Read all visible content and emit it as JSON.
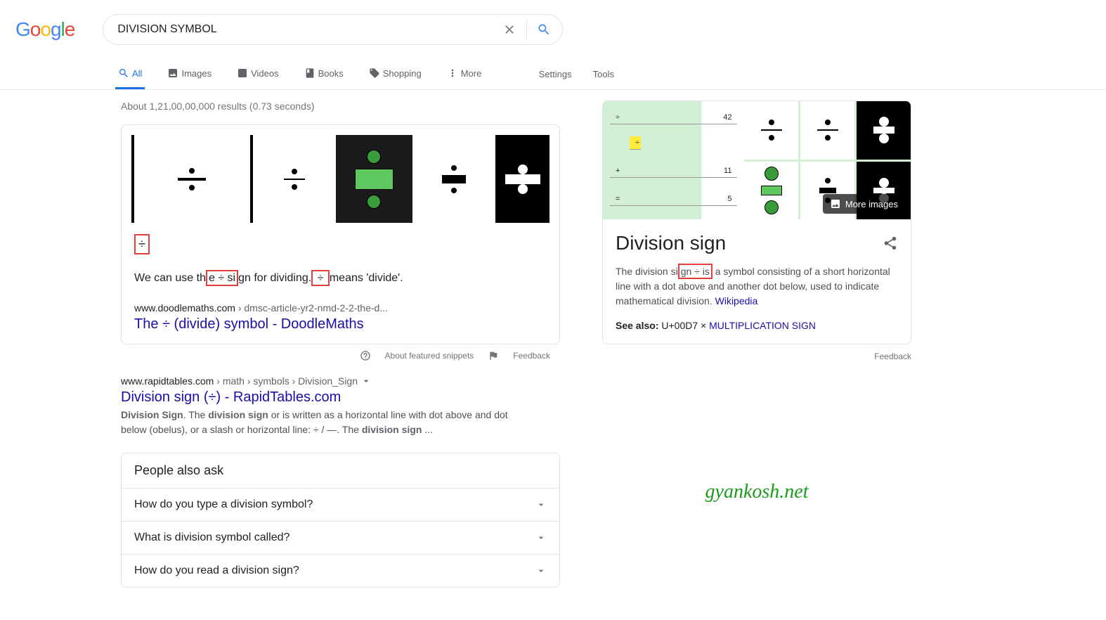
{
  "search": {
    "query": "DIVISION SYMBOL"
  },
  "tabs": {
    "all": "All",
    "images": "Images",
    "videos": "Videos",
    "books": "Books",
    "shopping": "Shopping",
    "more": "More",
    "settings": "Settings",
    "tools": "Tools"
  },
  "stats": "About 1,21,00,00,000 results (0.73 seconds)",
  "featured": {
    "symbol": "÷",
    "text_pre": "We can use th",
    "text_mid1": "e ÷ si",
    "text_mid2": "gn for dividing.",
    "text_box2": " ÷ ",
    "text_post": "means 'divide'.",
    "url": "www.doodlemaths.com",
    "path": " › dmsc-article-yr2-nmd-2-2-the-d...",
    "title": "The ÷ (divide) symbol - DoodleMaths",
    "about": "About featured snippets",
    "feedback": "Feedback"
  },
  "results": [
    {
      "url": "www.rapidtables.com",
      "path": " › math › symbols › Division_Sign",
      "title": "Division sign (÷) - RapidTables.com",
      "snippet_b1": "Division Sign",
      "snippet_1": ". The ",
      "snippet_b2": "division sign",
      "snippet_2": " or is written as a horizontal line with dot above and dot below (obelus), or a slash or horizontal line: ÷ / —. The ",
      "snippet_b3": "division sign",
      "snippet_3": " ..."
    }
  ],
  "paa": {
    "title": "People also ask",
    "q1": "How do you type a division symbol?",
    "q2": "What is division symbol called?",
    "q3": "How do you read a division sign?"
  },
  "kp": {
    "title": "Division sign",
    "more_images": "More images",
    "desc_pre": "The division si",
    "desc_box": "gn ÷ is",
    "desc_post": " a symbol consisting of a short horizontal line with a dot above and another dot below, used to indicate mathematical division. ",
    "wiki": "Wikipedia",
    "seealso_label": "See also:",
    "seealso_code": " U+00D7 × ",
    "seealso_link": "MULTIPLICATION SIGN",
    "feedback": "Feedback",
    "cells": {
      "sym1": "÷",
      "val1": "42",
      "sym2": "÷",
      "sym3": "+",
      "val3": "11",
      "sym4": "=",
      "val4": "5"
    }
  },
  "watermark": "gyankosh.net"
}
